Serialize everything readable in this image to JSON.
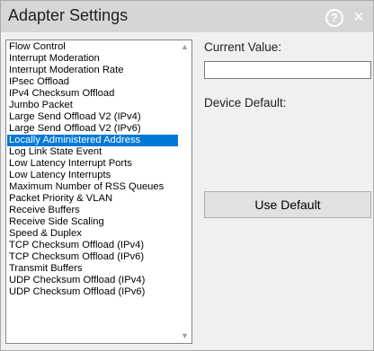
{
  "header": {
    "title": "Adapter Settings",
    "help_glyph": "?",
    "close_glyph": "×"
  },
  "properties": {
    "items": [
      "Flow Control",
      "Interrupt Moderation",
      "Interrupt Moderation Rate",
      "IPsec Offload",
      "IPv4 Checksum Offload",
      "Jumbo Packet",
      "Large Send Offload V2 (IPv4)",
      "Large Send Offload V2 (IPv6)",
      "Locally Administered Address",
      "Log Link State Event",
      "Low Latency Interrupt Ports",
      "Low Latency Interrupts",
      "Maximum Number of RSS Queues",
      "Packet Priority & VLAN",
      "Receive Buffers",
      "Receive Side Scaling",
      "Speed & Duplex",
      "TCP Checksum Offload (IPv4)",
      "TCP Checksum Offload (IPv6)",
      "Transmit Buffers",
      "UDP Checksum Offload (IPv4)",
      "UDP Checksum Offload (IPv6)"
    ],
    "selected_index": 8,
    "scroll_up_glyph": "▲",
    "scroll_down_glyph": "▼"
  },
  "detail": {
    "current_value_label": "Current Value:",
    "current_value": "",
    "device_default_label": "Device Default:",
    "use_default_label": "Use Default"
  },
  "colors": {
    "selection": "#0078d7",
    "header_bg": "#d6d6d6"
  }
}
